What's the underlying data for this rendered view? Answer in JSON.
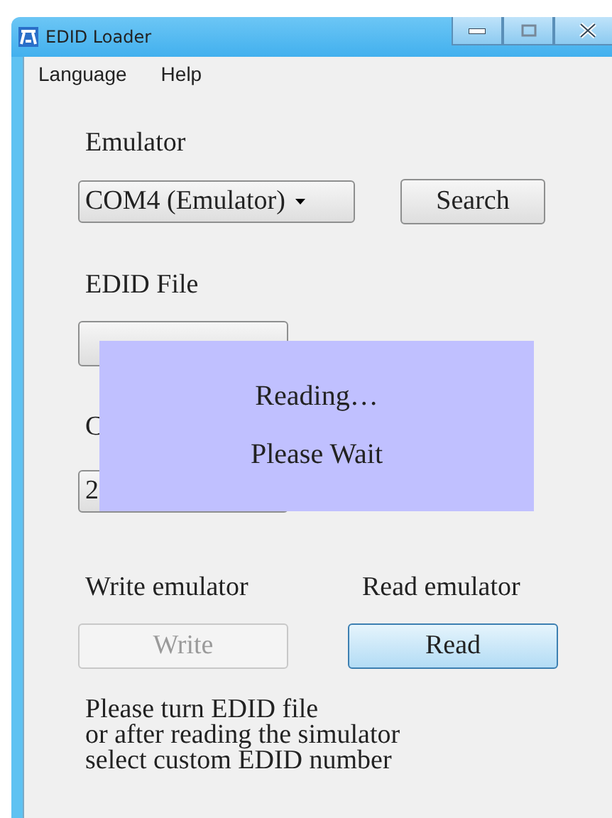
{
  "window": {
    "title": "EDID Loader"
  },
  "menu": [
    "Language",
    "Help"
  ],
  "emulator": {
    "label": "Emulator",
    "port": "COM4 (Emulator)",
    "button": "Search"
  },
  "edid_file": {
    "label": "EDID File"
  },
  "custom": {
    "label": "C",
    "value": "2"
  },
  "actions": [
    {
      "label": "Write emulator",
      "button": "Write",
      "disabled": true,
      "focused": false
    },
    {
      "label": "Read emulator",
      "button": "Read",
      "disabled": false,
      "focused": true
    }
  ],
  "note": "Please turn EDID file\nor after reading the simulator\nselect custom EDID number",
  "overlay": {
    "title": "Reading…",
    "message": "Please Wait"
  }
}
